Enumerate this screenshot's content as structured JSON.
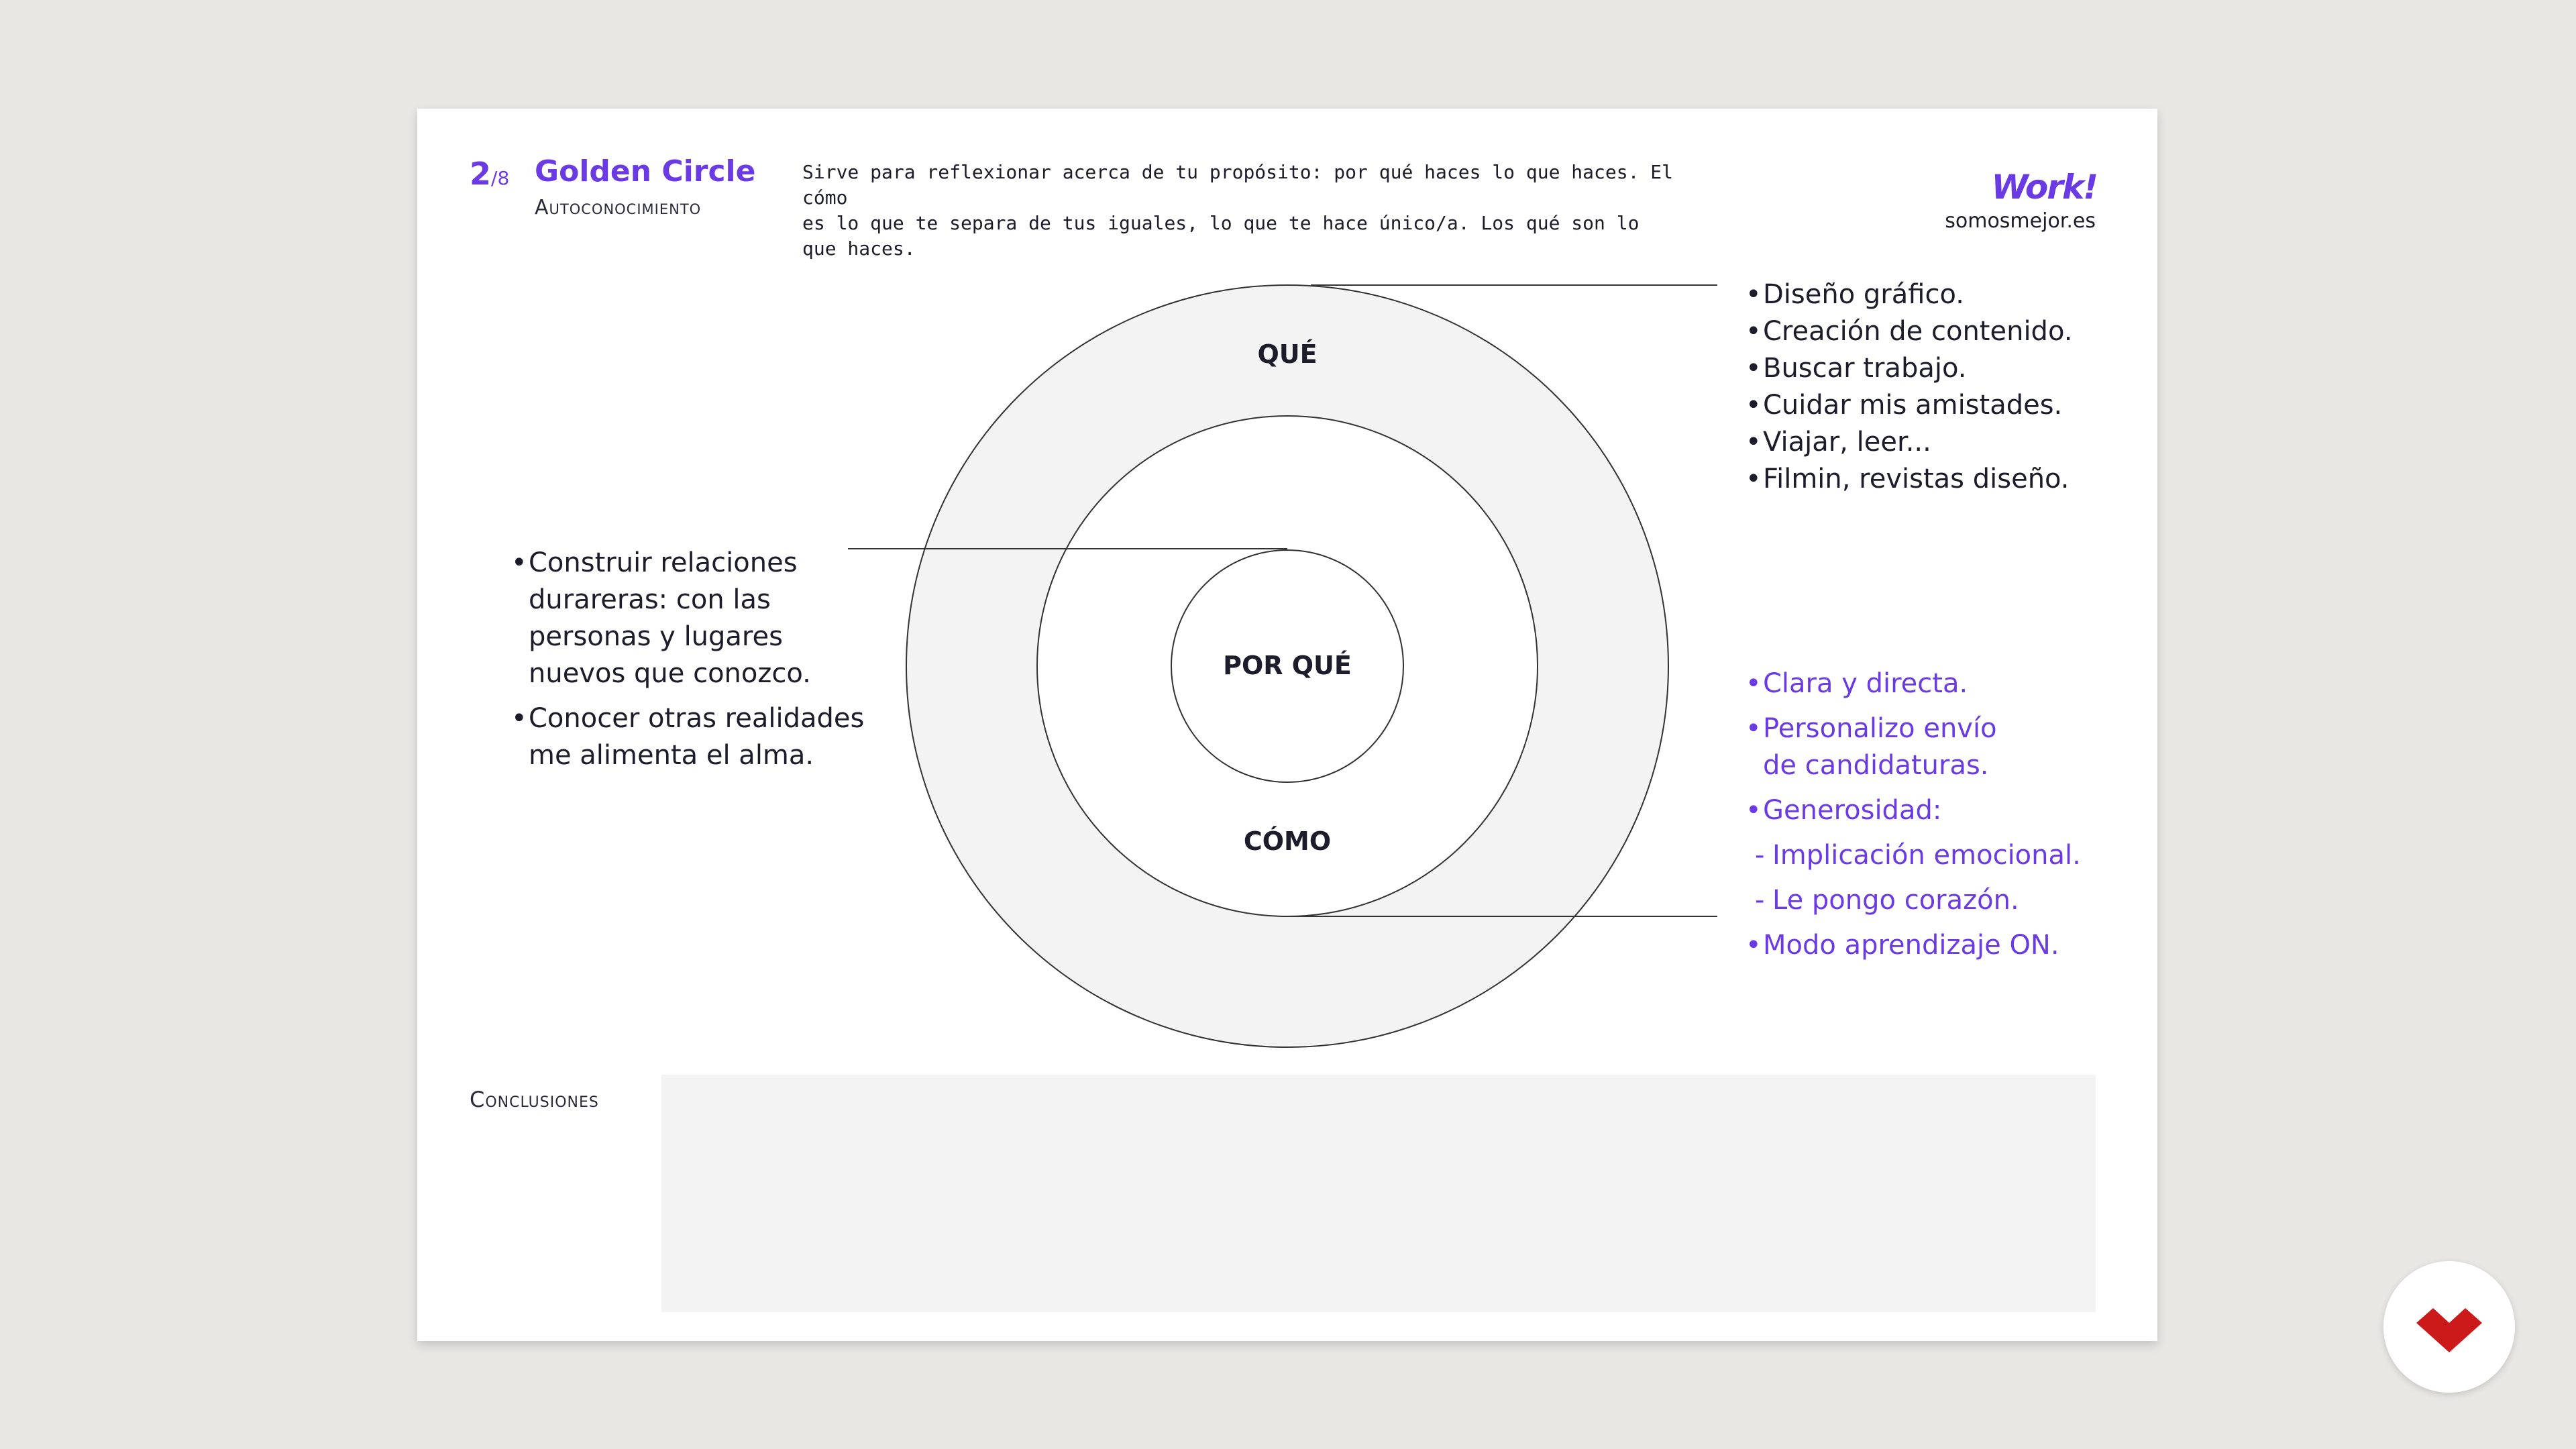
{
  "header": {
    "page_current": "2",
    "page_total": "/8",
    "title": "Golden Circle",
    "subtitle": "Autoconocimiento",
    "description_line1": "Sirve para reflexionar acerca de tu propósito: por qué haces lo que haces. El cómo",
    "description_line2": "es lo que te separa de tus iguales, lo que te hace único/a. Los qué son lo que haces.",
    "brand": "Work!",
    "url": "somosmejor.es"
  },
  "circle": {
    "outer_label": "QUÉ",
    "middle_label": "CÓMO",
    "inner_label": "POR QUÉ"
  },
  "que_items": [
    "Diseño gráfico.",
    "Creación de contenido.",
    "Buscar trabajo.",
    "Cuidar mis amistades.",
    "Viajar, leer...",
    "Filmin, revistas diseño."
  ],
  "porque_items": [
    {
      "line1": "Construir relaciones",
      "line2": "durareras: con las",
      "line3": "personas y lugares",
      "line4": "nuevos que conozco."
    },
    {
      "line1": "Conocer otras realidades",
      "line2": "me alimenta el alma."
    }
  ],
  "como_items": {
    "item1": "Clara y directa.",
    "item2_line1": "Personalizo envío",
    "item2_line2": "de candidaturas.",
    "item3": "Generosidad:",
    "sub1": "Implicación emocional.",
    "sub2": "Le pongo corazón.",
    "item4": "Modo aprendizaje ON."
  },
  "conclusions": {
    "label": "Conclusiones",
    "text": ""
  },
  "colors": {
    "accent": "#6a3be4",
    "background": "#e8e7e4",
    "ring_fill": "#f3f3f3",
    "logo_red": "#cc1a1a"
  },
  "icons": {
    "corner_logo": "red-chevron-logo-icon"
  }
}
